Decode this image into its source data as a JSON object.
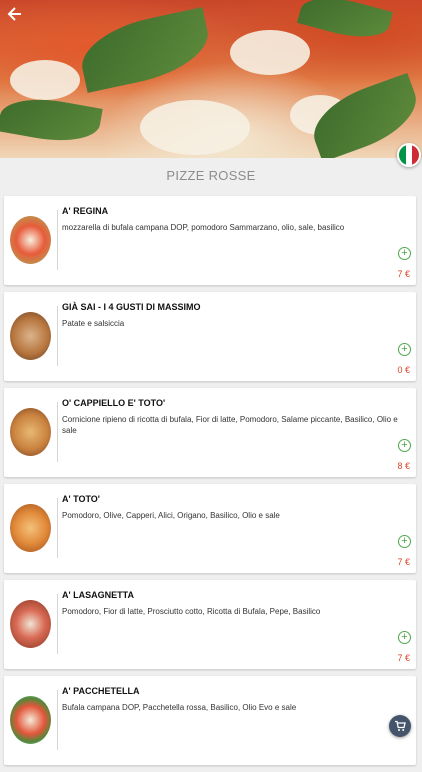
{
  "header": {
    "back_icon": "arrow-left-icon",
    "flag_icon": "italian-flag-icon",
    "flag_colors": [
      "#009246",
      "#ffffff",
      "#ce2b37"
    ]
  },
  "section": {
    "title": "PIZZE ROSSE"
  },
  "items": [
    {
      "name": "A' REGINA",
      "description": "mozzarella di bufala campana DOP, pomodoro Sammarzano, olio, sale, basilico",
      "price": "7 €"
    },
    {
      "name": "GIÀ SAI - I 4 GUSTI DI MASSIMO",
      "description": "Patate e salsiccia",
      "price": "0 €"
    },
    {
      "name": "O' CAPPIELLO E' TOTO'",
      "description": "Cornicione ripieno di ricotta di bufala, Fior di latte, Pomodoro, Salame piccante, Basilico, Olio e sale",
      "price": "8 €"
    },
    {
      "name": "A' TOTO'",
      "description": "Pomodoro, Olive, Capperi, Alici, Origano, Basilico, Olio e sale",
      "price": "7 €"
    },
    {
      "name": "A' LASAGNETTA",
      "description": "Pomodoro, Fior di latte, Prosciutto cotto, Ricotta di Bufala, Pepe, Basilico",
      "price": "7 €"
    },
    {
      "name": "A' PACCHETELLA",
      "description": "Bufala campana DOP, Pacchetella rossa, Basilico, Olio Evo e sale",
      "price": ""
    }
  ],
  "icons": {
    "add": "add-circle-icon",
    "cart": "cart-icon"
  },
  "colors": {
    "accent_green": "#4da84a",
    "price_red": "#d9452b",
    "fab": "#44556b"
  }
}
